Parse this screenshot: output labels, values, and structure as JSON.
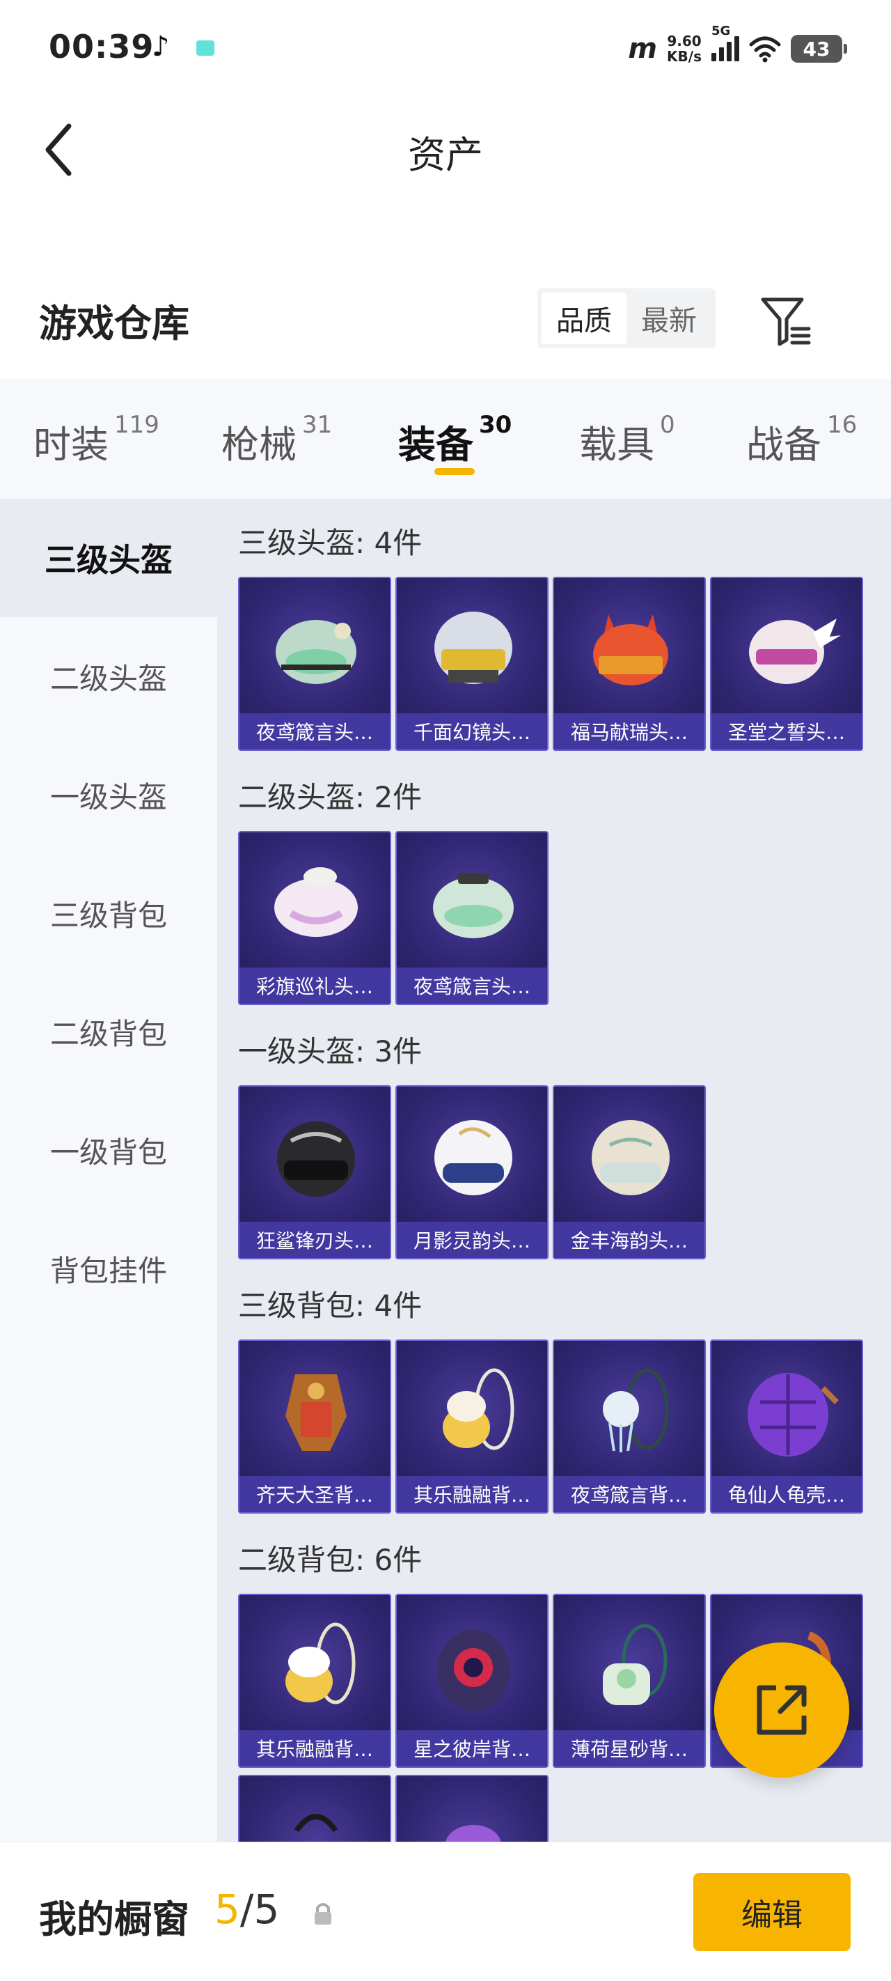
{
  "status": {
    "time": "00:39",
    "net_speed_value": "9.60",
    "net_speed_unit": "KB/s",
    "signal_label": "5G",
    "battery": "43"
  },
  "header": {
    "title": "资产"
  },
  "warehouse": {
    "title": "游戏仓库",
    "sort_options": [
      "品质",
      "最新"
    ],
    "sort_active": "品质"
  },
  "tabs": [
    {
      "label": "时装",
      "count": "119"
    },
    {
      "label": "枪械",
      "count": "31"
    },
    {
      "label": "装备",
      "count": "30"
    },
    {
      "label": "载具",
      "count": "0"
    },
    {
      "label": "战备",
      "count": "16"
    }
  ],
  "active_tab": "装备",
  "sidebar": {
    "items": [
      "三级头盔",
      "二级头盔",
      "一级头盔",
      "三级背包",
      "二级背包",
      "一级背包",
      "背包挂件"
    ],
    "active": "三级头盔"
  },
  "sections": [
    {
      "title": "三级头盔: 4件",
      "items": [
        "夜鸢箴言头…",
        "千面幻镜头…",
        "福马献瑞头…",
        "圣堂之誓头…"
      ]
    },
    {
      "title": "二级头盔: 2件",
      "items": [
        "彩旗巡礼头…",
        "夜鸢箴言头…"
      ]
    },
    {
      "title": "一级头盔: 3件",
      "items": [
        "狂鲨锋刃头…",
        "月影灵韵头…",
        "金丰海韵头…"
      ]
    },
    {
      "title": "三级背包: 4件",
      "items": [
        "齐天大圣背…",
        "其乐融融背…",
        "夜鸢箴言背…",
        "龟仙人龟壳…"
      ]
    },
    {
      "title": "二级背包: 6件",
      "items": [
        "其乐融融背…",
        "星之彼岸背…",
        "薄荷星砂背…",
        "…",
        "",
        ""
      ]
    }
  ],
  "showcase": {
    "label": "我的橱窗",
    "current": "5",
    "total": "/5",
    "edit_label": "编辑"
  },
  "colors": {
    "accent": "#f7b400",
    "card_bg": "#2f2570",
    "card_label_bg": "#463caa"
  }
}
